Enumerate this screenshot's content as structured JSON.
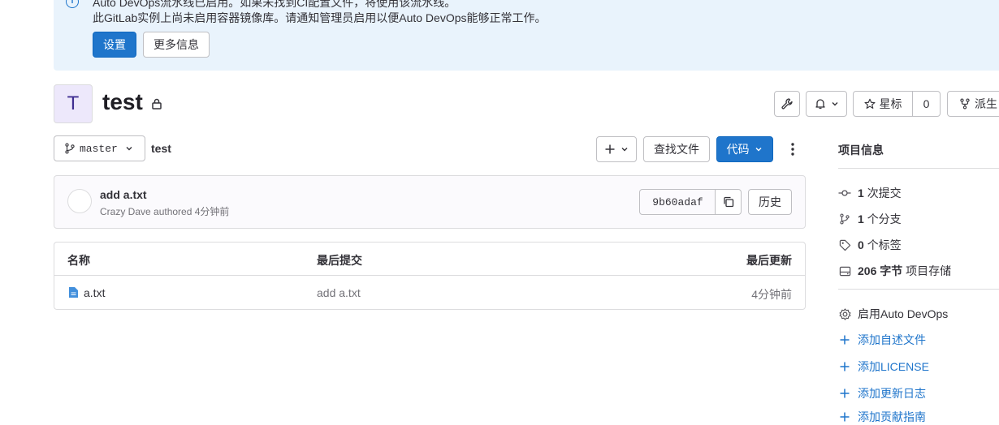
{
  "alert": {
    "line1": "Auto DevOps流水线已启用。如果未找到CI配置文件，将使用该流水线。",
    "line2": "此GitLab实例上尚未启用容器镜像库。请通知管理员启用以便Auto DevOps能够正常工作。",
    "settings_label": "设置",
    "more_info_label": "更多信息"
  },
  "project": {
    "avatar_letter": "T",
    "name": "test",
    "star_label": "星标",
    "star_count": "0",
    "fork_label": "派生"
  },
  "toolbar": {
    "branch": "master",
    "path": "test",
    "find_file_label": "查找文件",
    "code_label": "代码"
  },
  "commit": {
    "title": "add a.txt",
    "author_line": "Crazy Dave authored 4分钟前",
    "sha": "9b60adaf",
    "history_label": "历史"
  },
  "files": {
    "headers": [
      "名称",
      "最后提交",
      "最后更新"
    ],
    "rows": [
      {
        "name": "a.txt",
        "last_commit": "add a.txt",
        "updated": "4分钟前"
      }
    ]
  },
  "sidebar": {
    "heading": "项目信息",
    "commits": {
      "count": "1",
      "label": "次提交"
    },
    "branches": {
      "count": "1",
      "label": "个分支"
    },
    "tags": {
      "count": "0",
      "label": "个标签"
    },
    "storage": {
      "count": "206 字节",
      "label": "项目存储"
    },
    "links": [
      "启用Auto DevOps",
      "添加自述文件",
      "添加LICENSE",
      "添加更新日志",
      "添加贡献指南"
    ]
  },
  "colors": {
    "primary": "#1f75cb",
    "alert_bg": "#e9f3fc"
  }
}
